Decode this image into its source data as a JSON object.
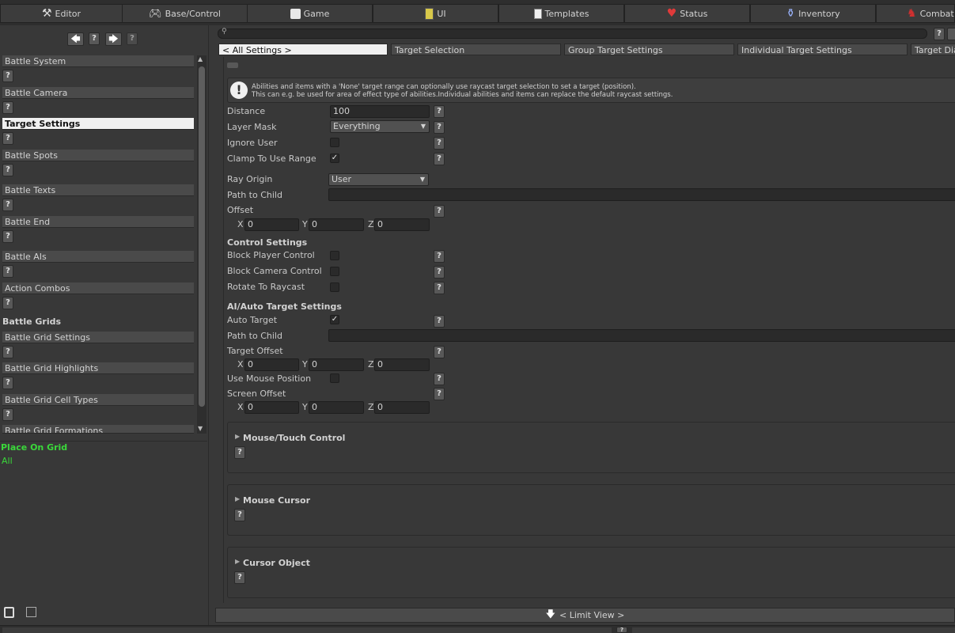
{
  "tabs": [
    {
      "label": "Editor",
      "icon": "tools-icon"
    },
    {
      "label": "Base/Control",
      "icon": "gamepad-icon"
    },
    {
      "label": "Game",
      "icon": "dice-icon"
    },
    {
      "label": "UI",
      "icon": "ui-icon"
    },
    {
      "label": "Templates",
      "icon": "document-icon"
    },
    {
      "label": "Status",
      "icon": "heart-icon"
    },
    {
      "label": "Inventory",
      "icon": "potion-icon"
    },
    {
      "label": "Combat",
      "icon": "fighter-icon"
    }
  ],
  "nav": {
    "help": "?",
    "help2": "?"
  },
  "sidebar": {
    "items": [
      "Battle System",
      "Battle Camera",
      "Target Settings",
      "Battle Spots",
      "Battle Texts",
      "Battle End",
      "Battle AIs",
      "Action Combos"
    ],
    "group": "Battle Grids",
    "grid_items": [
      "Battle Grid Settings",
      "Battle Grid Highlights",
      "Battle Grid Cell Types",
      "Battle Grid Formations"
    ],
    "help": "?"
  },
  "info_panel": {
    "title": "Place On Grid",
    "value": "All"
  },
  "search": {
    "placeholder": "",
    "help": "?"
  },
  "subtabs": [
    "< All Settings >",
    "Target Selection",
    "Group Target Settings",
    "Individual Target Settings",
    "Target Dia"
  ],
  "notice": {
    "line1": "Abilities and items with a 'None' target range can optionally use raycast target selection to set a target (position).",
    "line2": "This can e.g. be used for area of effect type of abilities.Individual abilities and items can replace the default raycast settings."
  },
  "form": {
    "distance_label": "Distance",
    "distance_value": "100",
    "layer_mask_label": "Layer Mask",
    "layer_mask_value": "Everything",
    "ignore_user_label": "Ignore User",
    "clamp_label": "Clamp To Use Range",
    "ray_origin_label": "Ray Origin",
    "ray_origin_value": "User",
    "path_child_label": "Path to Child",
    "offset_label": "Offset",
    "x": "X",
    "y": "Y",
    "z": "Z",
    "zero": "0",
    "control_title": "Control Settings",
    "block_player_label": "Block Player Control",
    "block_camera_label": "Block Camera Control",
    "rotate_label": "Rotate To Raycast",
    "ai_title": "AI/Auto Target Settings",
    "auto_target_label": "Auto Target",
    "path_child2_label": "Path to Child",
    "target_offset_label": "Target Offset",
    "use_mouse_label": "Use Mouse Position",
    "screen_offset_label": "Screen Offset",
    "check": "✓",
    "help": "?"
  },
  "foldouts": [
    "Mouse/Touch Control",
    "Mouse Cursor",
    "Cursor Object"
  ],
  "bottom": {
    "limit_view": "< Limit View >",
    "help": "?"
  }
}
